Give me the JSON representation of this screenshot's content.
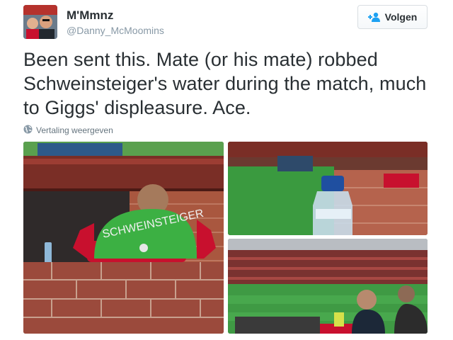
{
  "author": {
    "display_name": "M'Mmnz",
    "handle": "@Danny_McMoomins"
  },
  "follow_button": {
    "label": "Volgen"
  },
  "tweet": {
    "text": "Been sent this. Mate (or his mate) robbed Schweinsteiger's water during the match, much to Giggs' displeasure. Ace."
  },
  "translate_link": {
    "label": "Vertaling weergeven"
  },
  "photos": {
    "main": {
      "shirt_text": "SCHWEINSTEIGER"
    }
  },
  "colors": {
    "accent": "#1da1f2",
    "text": "#292f33",
    "muted": "#8899a6",
    "shirt_red": "#c8102e",
    "shirt_green": "#3cb043",
    "brick": "#9b4a3c",
    "pitch": "#3a9a3f"
  },
  "icons": {
    "follow": "add-user-icon",
    "translate": "globe-icon"
  }
}
